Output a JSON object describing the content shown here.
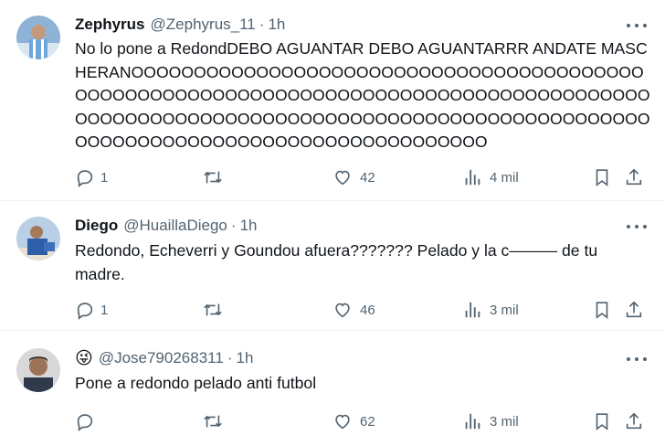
{
  "tweets": [
    {
      "name": "Zephyrus",
      "handle": "@Zephyrus_11",
      "time": "1h",
      "text": "No lo pone a RedondDEBO AGUANTAR DEBO AGUANTARRR ANDATE MASCHERANOOOOOOOOOOOOOOOOOOOOOOOOOOOOOOOOOOOOOOOOOOOOOOOOOOOOOOOOOOOOOOOOOOOOOOOOOOOOOOOOOOOOOOOOOOOOOOOOOOOOOOOOOOOOOOOOOOOOOOOOOOOOOOOOOOOOOOOOOOOOOOOOOOOOOOOOOOOOOOOOOOOOOO",
      "replies": "1",
      "retweets": "",
      "likes": "42",
      "views": "4 mil"
    },
    {
      "name": "Diego",
      "handle": "@HuaillaDiego",
      "time": "1h",
      "text": "Redondo, Echeverri y Goundou afuera??????? Pelado y la c——— de tu madre.",
      "replies": "1",
      "retweets": "",
      "likes": "46",
      "views": "3 mil"
    },
    {
      "emoji": "😜",
      "handle": "@Jose790268311",
      "time": "1h",
      "text": "Pone a redondo pelado anti futbol",
      "replies": "",
      "retweets": "",
      "likes": "62",
      "views": "3 mil"
    }
  ],
  "separator": "·",
  "icons": [
    "reply-icon",
    "retweet-icon",
    "like-icon",
    "views-icon",
    "bookmark-icon",
    "share-icon",
    "more-icon"
  ],
  "colors": {
    "text": "#0f1419",
    "muted": "#536471",
    "divider": "#eff3f4"
  }
}
